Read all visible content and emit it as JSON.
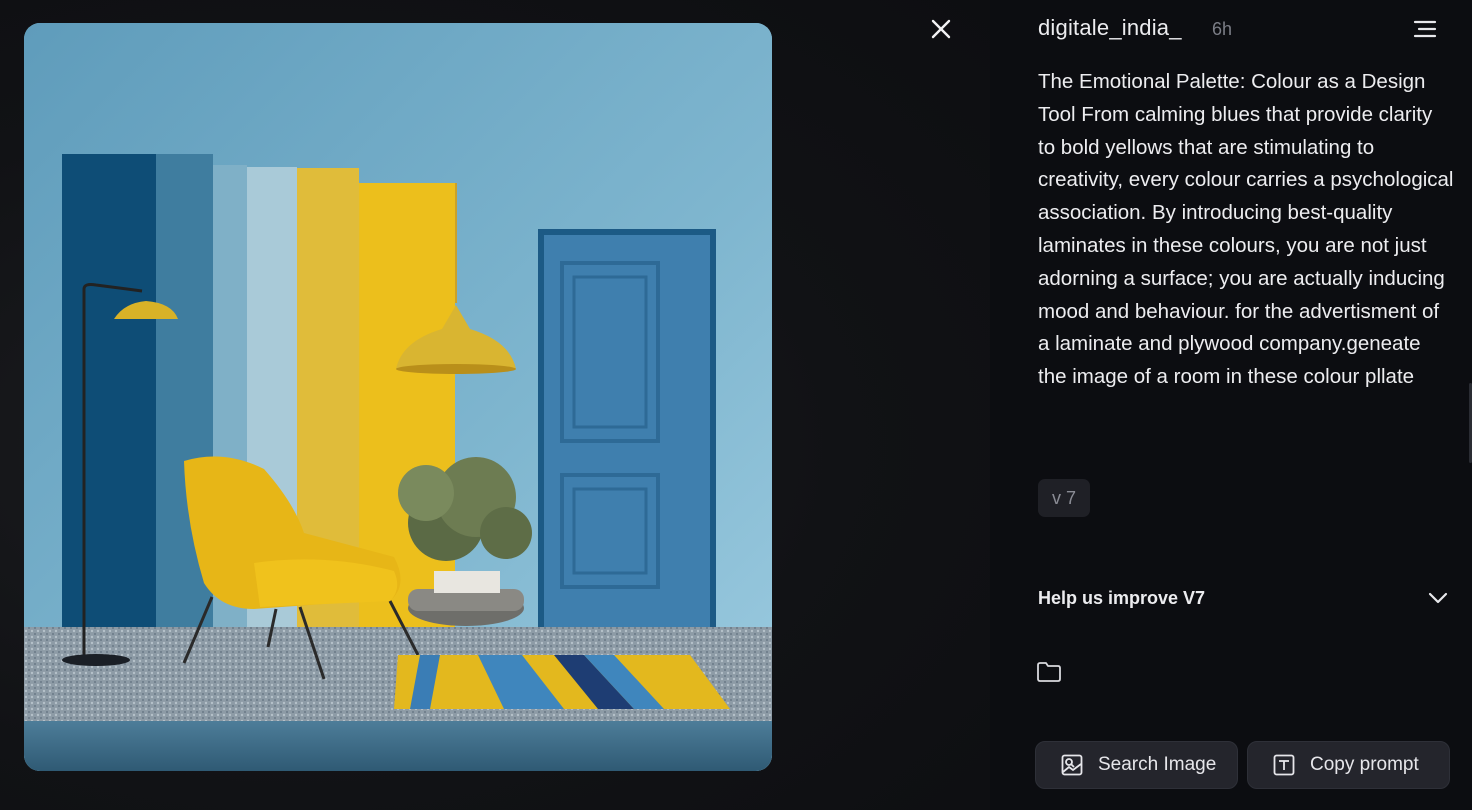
{
  "post": {
    "username": "digitale_india_",
    "time_ago": "6h",
    "prompt": "The Emotional Palette: Colour as a Design Tool From calming blues that provide clarity to bold yellows that are stimulating to creativity, every colour carries a psychological association. By introducing best-quality laminates in these colours, you are not just adorning a surface; you are actually inducing mood and behaviour. for the advertisment of a laminate and plywood company.geneate the image of a room in these colour pllate",
    "version_badge": "v 7"
  },
  "feedback": {
    "label": "Help us improve V7"
  },
  "actions": {
    "search_label": "Search Image",
    "copy_label": "Copy prompt"
  },
  "icons": {
    "close": "close-icon",
    "menu": "menu-icon",
    "chevron": "chevron-down-icon",
    "folder": "folder-icon",
    "search": "image-search-icon",
    "copy": "text-icon"
  },
  "colors": {
    "background": "#0c0d11",
    "button_bg": "#24252c",
    "badge_bg": "#1f2026",
    "muted_text": "#7b7d86"
  }
}
